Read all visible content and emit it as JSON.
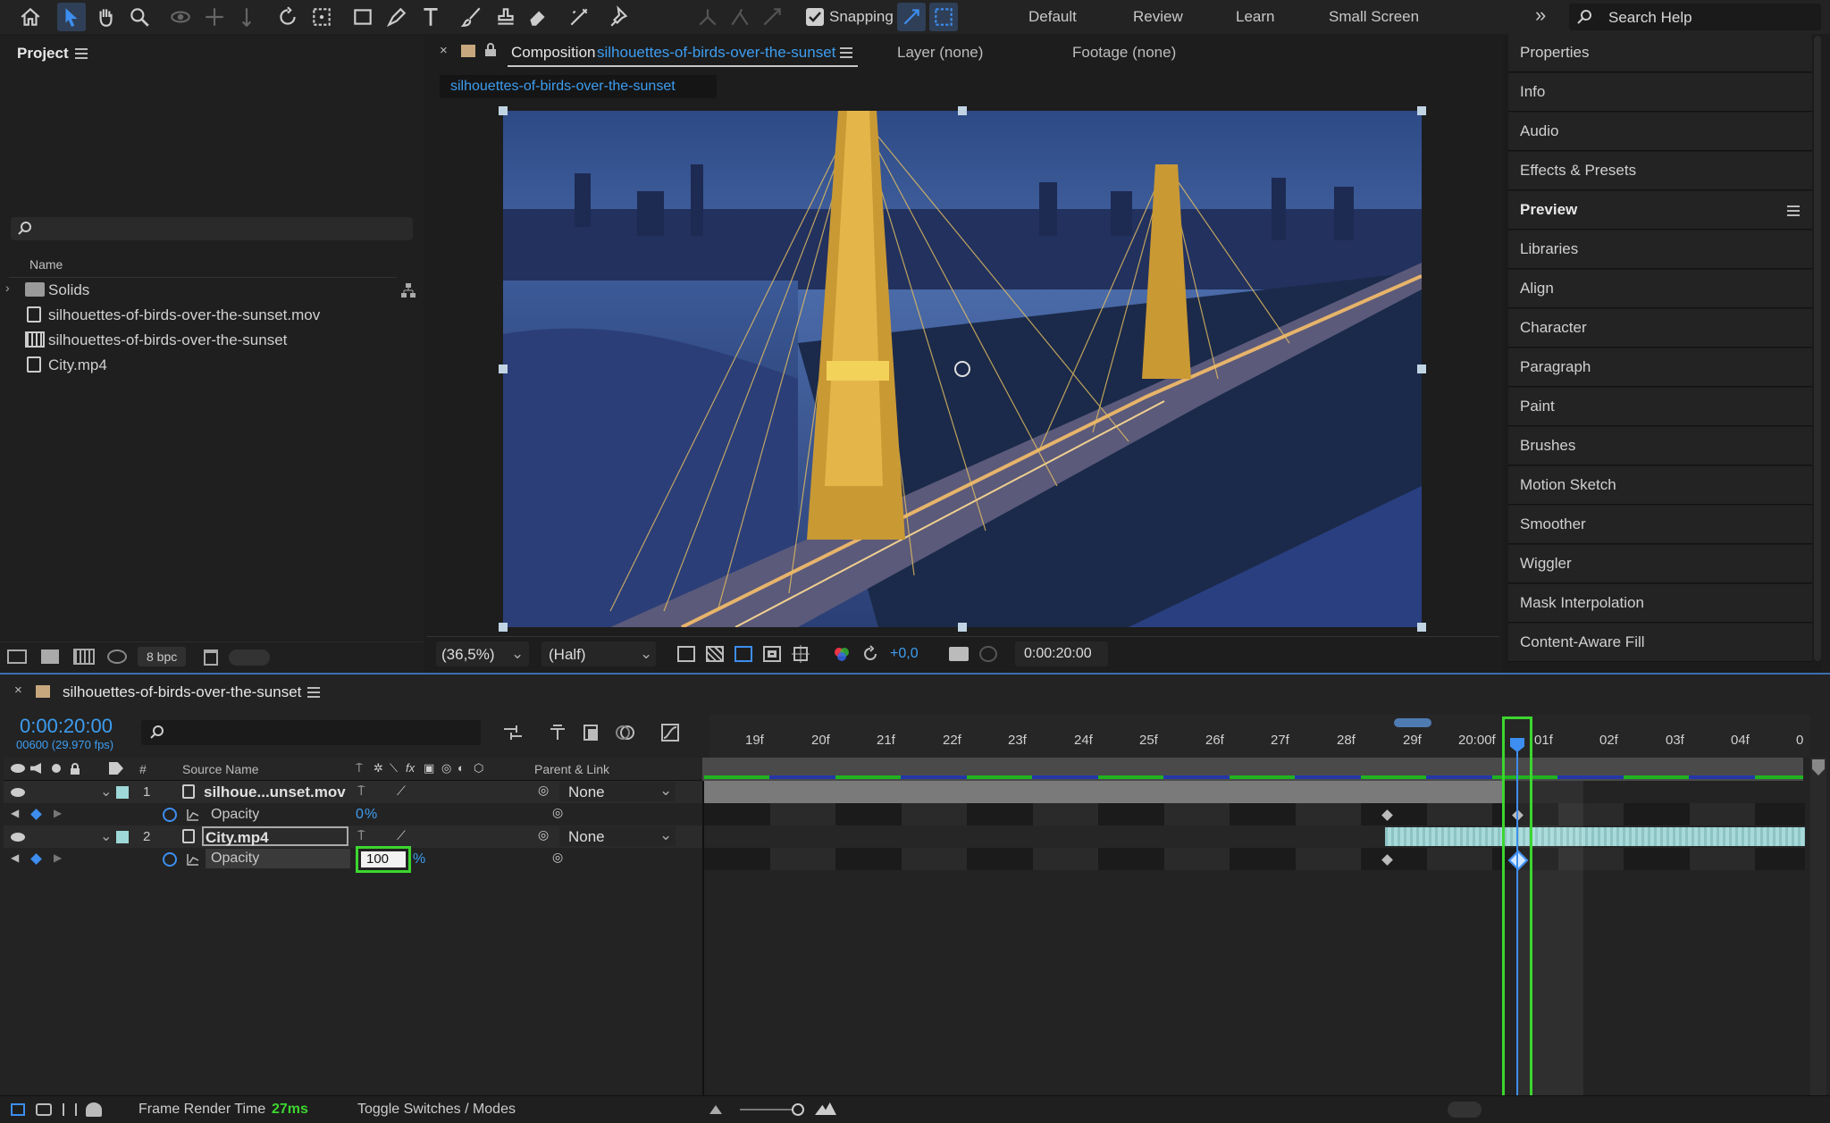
{
  "toolbar": {
    "snapping_label": "Snapping",
    "workspaces": [
      "Default",
      "Review",
      "Learn",
      "Small Screen"
    ],
    "overflow": "»",
    "search_placeholder": "Search Help"
  },
  "project": {
    "title": "Project",
    "col_name": "Name",
    "items": [
      {
        "name": "Solids",
        "icon": "folder-icon"
      },
      {
        "name": "silhouettes-of-birds-over-the-sunset.mov",
        "icon": "footage-icon"
      },
      {
        "name": "silhouettes-of-birds-over-the-sunset",
        "icon": "composition-icon"
      },
      {
        "name": "City.mp4",
        "icon": "footage-icon"
      }
    ],
    "bpc": "8 bpc"
  },
  "viewer": {
    "comp_label": "Composition",
    "comp_name": "silhouettes-of-birds-over-the-sunset",
    "layer_tab": "Layer (none)",
    "footage_tab": "Footage (none)",
    "sub_tab": "silhouettes-of-birds-over-the-sunset",
    "zoom": "(36,5%)",
    "resolution": "(Half)",
    "exposure": "+0,0",
    "timecode": "0:00:20:00"
  },
  "right_panel": [
    "Properties",
    "Info",
    "Audio",
    "Effects & Presets",
    "Preview",
    "Libraries",
    "Align",
    "Character",
    "Paragraph",
    "Paint",
    "Brushes",
    "Motion Sketch",
    "Smoother",
    "Wiggler",
    "Mask Interpolation",
    "Content-Aware Fill"
  ],
  "timeline": {
    "comp_name": "silhouettes-of-birds-over-the-sunset",
    "timecode": "0:00:20:00",
    "frame_info": "00600 (29.970 fps)",
    "col_number": "#",
    "col_source": "Source Name",
    "col_parent": "Parent & Link",
    "layers": [
      {
        "num": "1",
        "name": "silhoue...unset.mov",
        "parent": "None",
        "prop": "Opacity",
        "value": "0",
        "unit": "%"
      },
      {
        "num": "2",
        "name": "City.mp4",
        "parent": "None",
        "prop": "Opacity",
        "value": "100",
        "unit": "%"
      }
    ],
    "ticks": [
      "19f",
      "20f",
      "21f",
      "22f",
      "23f",
      "24f",
      "25f",
      "26f",
      "27f",
      "28f",
      "29f",
      "20:00f",
      "01f",
      "02f",
      "03f",
      "04f",
      "0"
    ],
    "render_label": "Frame Render Time",
    "render_value": "27ms",
    "toggle_label": "Toggle Switches / Modes"
  },
  "colors": {
    "accent": "#2d8ceb",
    "highlight": "#3cd62f",
    "label": "#9ed8d8"
  }
}
